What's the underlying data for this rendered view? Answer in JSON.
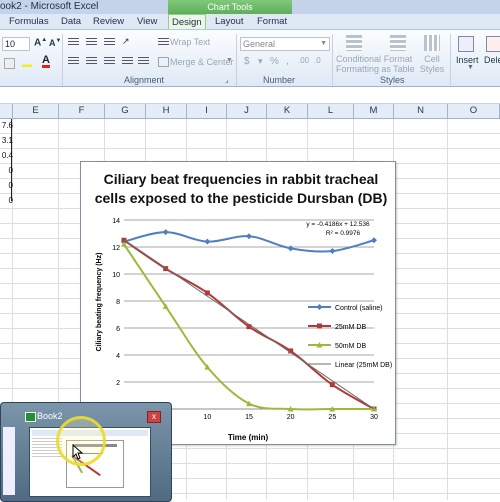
{
  "window": {
    "title": "ook2 - Microsoft Excel",
    "context_tab": "Chart Tools"
  },
  "ribbon_tabs": [
    "Formulas",
    "Data",
    "Review",
    "View",
    "Design",
    "Layout",
    "Format"
  ],
  "ribbon": {
    "font_size": "10",
    "wrap_text": "Wrap Text",
    "merge_center": "Merge & Center",
    "number_format": "General",
    "conditional_formatting": [
      "Conditional",
      "Formatting"
    ],
    "format_as_table": [
      "Format",
      "as Table"
    ],
    "cell_styles": [
      "Cell",
      "Styles"
    ],
    "insert": "Insert",
    "delete": "Delet",
    "groups": {
      "alignment": "Alignment",
      "number": "Number",
      "styles": "Styles"
    }
  },
  "columns": [
    "E",
    "F",
    "G",
    "H",
    "I",
    "J",
    "K",
    "L",
    "M",
    "N",
    "O"
  ],
  "cell_values": [
    "7.6",
    "3.1",
    "0.4",
    "0",
    "0",
    "0"
  ],
  "chart_data": {
    "type": "line",
    "title": "Ciliary beat frequencies in rabbit tracheal cells exposed to the pesticide Dursban (DB)",
    "xlabel": "Time (min)",
    "ylabel": "Ciliary beating frequency (Hz)",
    "x": [
      0,
      5,
      10,
      15,
      20,
      25,
      30
    ],
    "xticks": [
      "10",
      "15",
      "20",
      "25",
      "30"
    ],
    "ylim": [
      0,
      14
    ],
    "yticks": [
      "14",
      "12",
      "10",
      "8",
      "6",
      "4",
      "2"
    ],
    "grid": true,
    "legend_position": "right",
    "series": [
      {
        "name": "Control (saline)",
        "color": "#4f7fc0",
        "marker": "diamond",
        "values": [
          12.4,
          13.1,
          12.4,
          12.8,
          11.9,
          11.7,
          12.5
        ]
      },
      {
        "name": "25mM DB",
        "color": "#b23a36",
        "marker": "square",
        "values": [
          12.5,
          10.4,
          8.6,
          6.1,
          4.3,
          1.8,
          0.0
        ]
      },
      {
        "name": "50mM DB",
        "color": "#9aba3c",
        "marker": "triangle",
        "values": [
          12.2,
          7.6,
          3.1,
          0.4,
          0,
          0,
          0
        ]
      },
      {
        "name": "Linear (25mM DB)",
        "color": "#6b6b6b",
        "marker": "none",
        "values": [
          12.536,
          10.443,
          8.35,
          6.257,
          4.164,
          2.071,
          -0.022
        ]
      }
    ],
    "annotations": [
      "y = -0.4186x + 12.536",
      "R² = 0.9976"
    ]
  },
  "taskbar_thumbnail": {
    "title": "Book2",
    "close_glyph": "x"
  }
}
